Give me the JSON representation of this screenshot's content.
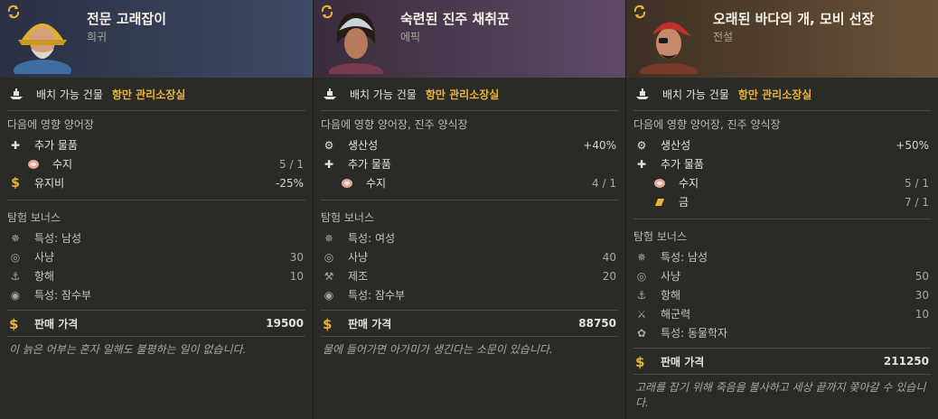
{
  "cards": [
    {
      "name": "전문 고래잡이",
      "rarity": "희귀",
      "building_label": "배치 가능 건물",
      "building_value": "항만 관리소장실",
      "affects": "다음에 영향 양어장",
      "effects": [
        {
          "label": "추가 물품",
          "value": ""
        },
        {
          "label": "수지",
          "value": "5 / 1"
        },
        {
          "label": "유지비",
          "value": "-25%"
        }
      ],
      "expedition_title": "탐험 보너스",
      "expedition": [
        {
          "label": "특성:  남성",
          "value": ""
        },
        {
          "label": "사냥",
          "value": "30"
        },
        {
          "label": "항해",
          "value": "10"
        },
        {
          "label": "특성:  잠수부",
          "value": ""
        }
      ],
      "price_label": "판매 가격",
      "price_value": "19500",
      "quote": "이 늙은 어부는 혼자 일해도 불평하는 일이 없습니다."
    },
    {
      "name": "숙련된 진주 채취꾼",
      "rarity": "에픽",
      "building_label": "배치 가능 건물",
      "building_value": "항만 관리소장실",
      "affects": "다음에 영향 양어장, 진주 양식장",
      "effects": [
        {
          "label": "생산성",
          "value": "+40%"
        },
        {
          "label": "추가 물품",
          "value": ""
        },
        {
          "label": "수지",
          "value": "4 / 1"
        }
      ],
      "expedition_title": "탐험 보너스",
      "expedition": [
        {
          "label": "특성:  여성",
          "value": ""
        },
        {
          "label": "사냥",
          "value": "40"
        },
        {
          "label": "제조",
          "value": "20"
        },
        {
          "label": "특성:  잠수부",
          "value": ""
        }
      ],
      "price_label": "판매 가격",
      "price_value": "88750",
      "quote": "물에 들어가면 아가미가 생긴다는 소문이 있습니다."
    },
    {
      "name": "오래된 바다의 개, 모비 선장",
      "rarity": "전설",
      "building_label": "배치 가능 건물",
      "building_value": "항만 관리소장실",
      "affects": "다음에 영향 양어장, 진주 양식장",
      "effects": [
        {
          "label": "생산성",
          "value": "+50%"
        },
        {
          "label": "추가 물품",
          "value": ""
        },
        {
          "label": "수지",
          "value": "5 / 1"
        },
        {
          "label": "금",
          "value": "7 / 1"
        }
      ],
      "expedition_title": "탐험 보너스",
      "expedition": [
        {
          "label": "특성:  남성",
          "value": ""
        },
        {
          "label": "사냥",
          "value": "50"
        },
        {
          "label": "항해",
          "value": "30"
        },
        {
          "label": "해군력",
          "value": "10"
        },
        {
          "label": "특성:  동물학자",
          "value": ""
        }
      ],
      "price_label": "판매 가격",
      "price_value": "211250",
      "quote": "고래를 잡기 위해 죽음을 불사하고 세상 끝까지 쫓아갈 수 있습니다."
    }
  ],
  "colors": {
    "accent": "#e8b53a",
    "text": "#e6e2d8",
    "muted": "#a9a7a0",
    "panel": "#2a2a26"
  }
}
